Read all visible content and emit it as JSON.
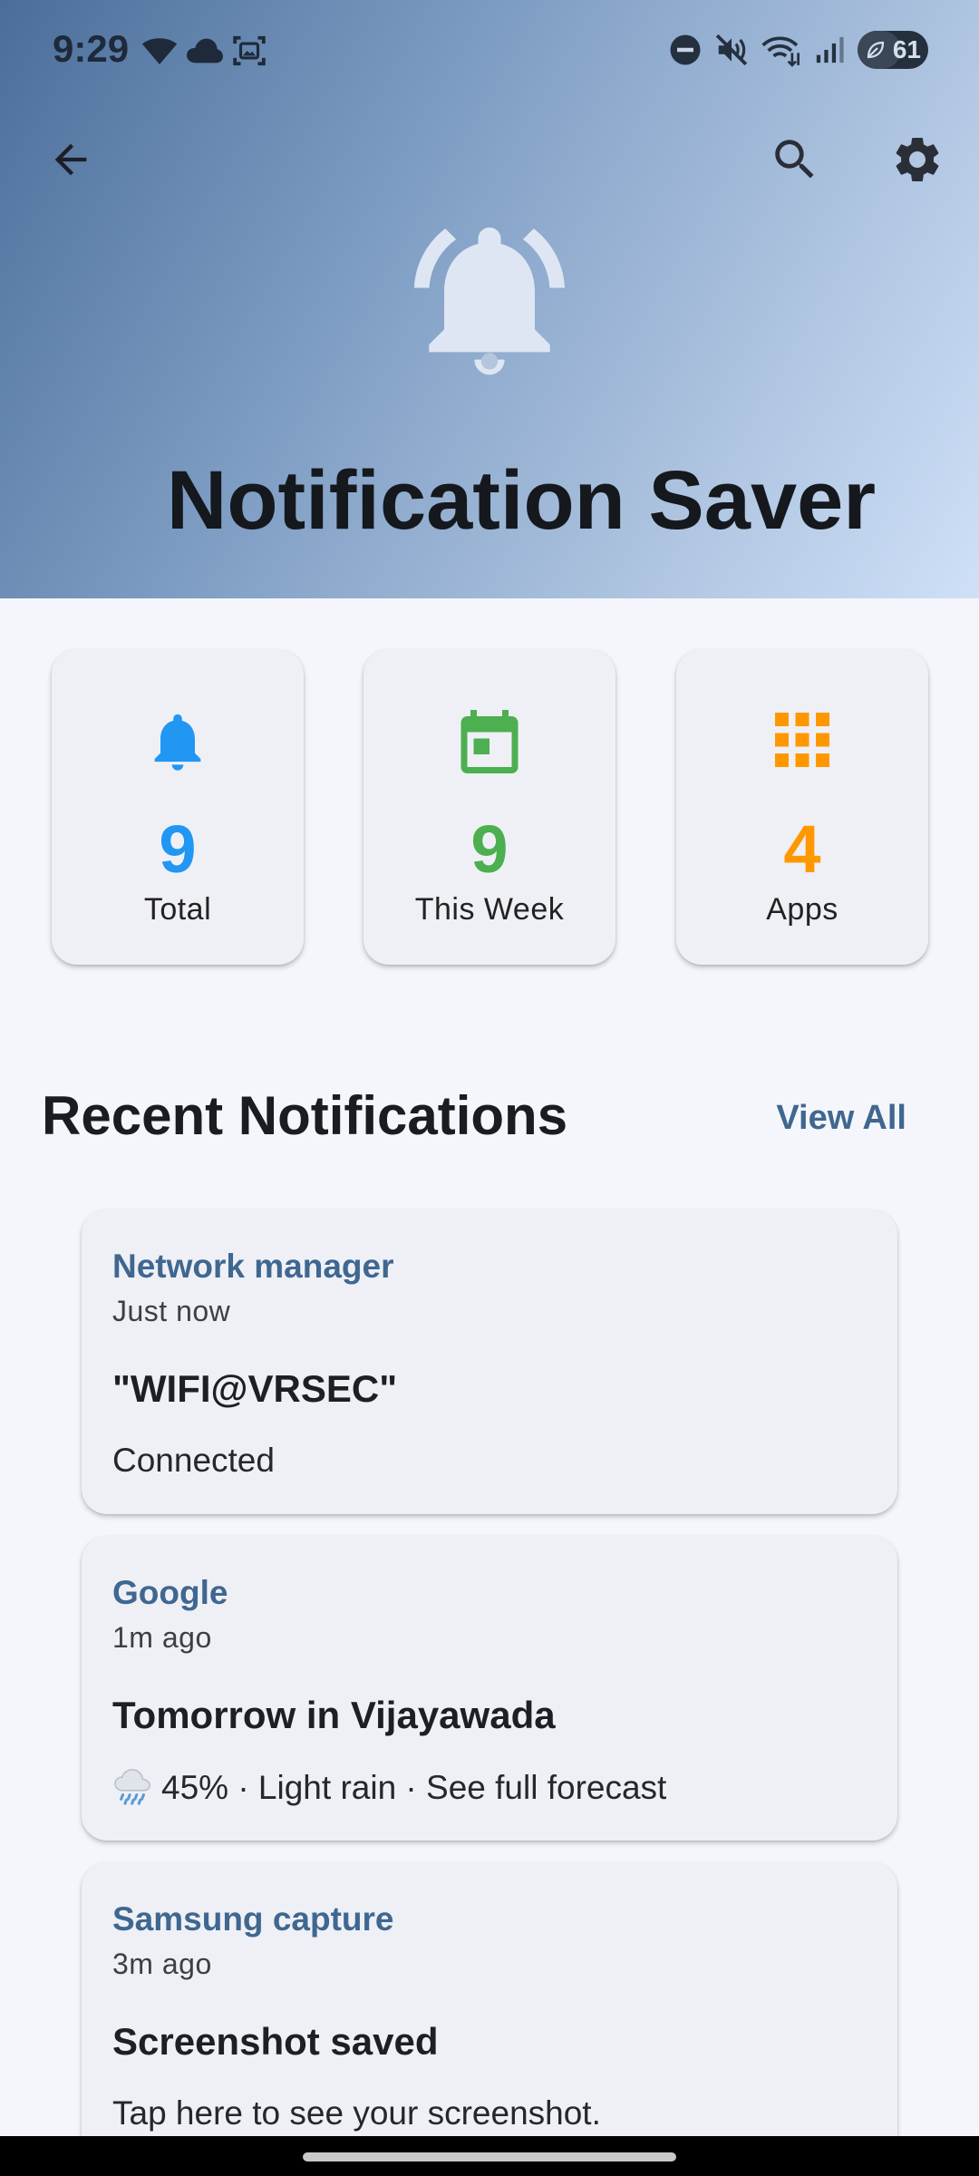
{
  "status_bar": {
    "time": "9:29",
    "battery": "61",
    "battery_fraction": 0.61
  },
  "header": {
    "title": "Notification Saver",
    "back_icon": "arrow-back-icon",
    "search_icon": "search-icon",
    "settings_icon": "gear-icon",
    "hero_icon": "bell-ringing-icon"
  },
  "stats": [
    {
      "icon": "bell-icon",
      "value": "9",
      "label": "Total",
      "color": "#2196f3"
    },
    {
      "icon": "calendar-icon",
      "value": "9",
      "label": "This Week",
      "color": "#4caf50"
    },
    {
      "icon": "apps-grid-icon",
      "value": "4",
      "label": "Apps",
      "color": "#ff9800"
    }
  ],
  "recent": {
    "title": "Recent Notifications",
    "view_all": "View All"
  },
  "notifications": [
    {
      "app": "Network manager",
      "time": "Just now",
      "title": "\"WIFI@VRSEC\"",
      "body": "Connected"
    },
    {
      "app": "Google",
      "time": "1m ago",
      "title": "Tomorrow in Vijayawada",
      "body_icon": "rain-cloud-icon",
      "body": "45% · Light rain · See full forecast"
    },
    {
      "app": "Samsung capture",
      "time": "3m ago",
      "title": "Screenshot saved",
      "body": "Tap here to see your screenshot."
    }
  ],
  "colors": {
    "accent": "#3f6790",
    "header_start": "#4b6e99",
    "header_end": "#cfe0f7",
    "background": "#f5f6fb"
  }
}
